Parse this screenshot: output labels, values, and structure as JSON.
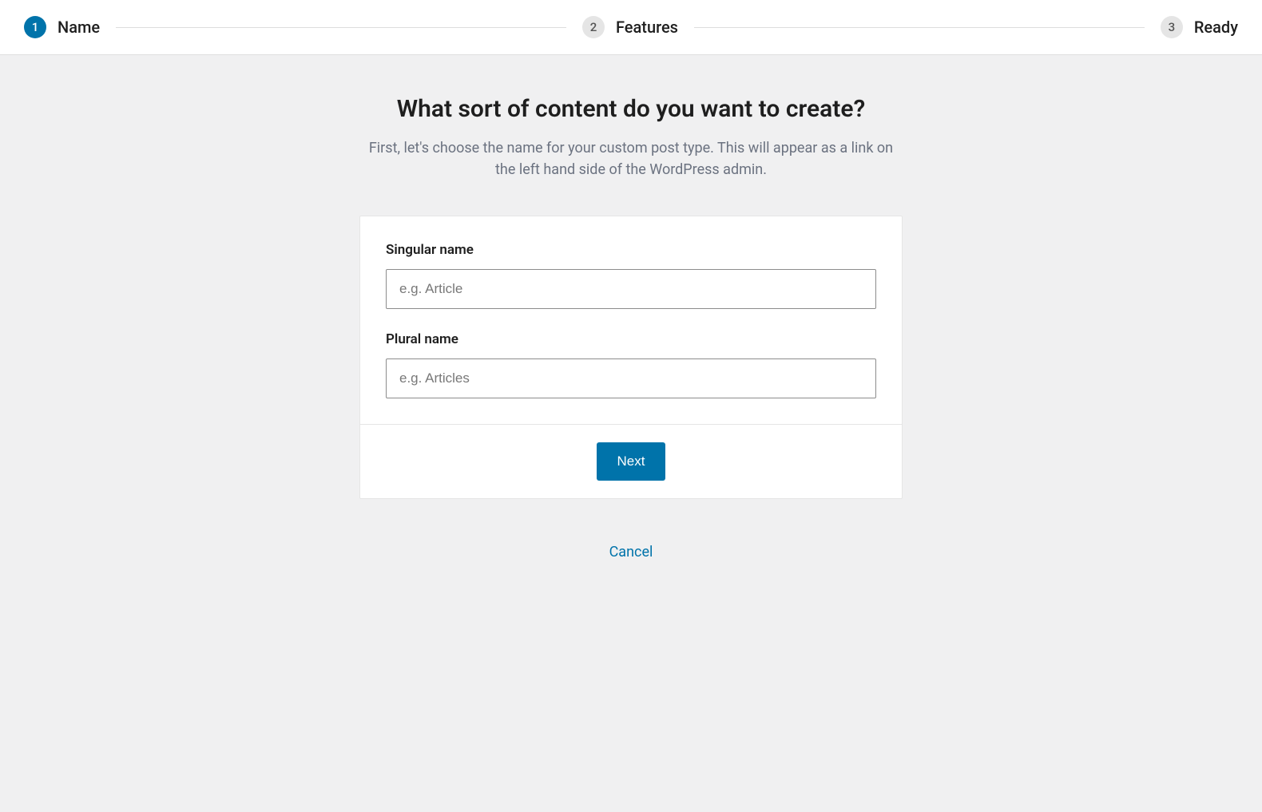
{
  "stepper": {
    "steps": [
      {
        "num": "1",
        "label": "Name",
        "active": true
      },
      {
        "num": "2",
        "label": "Features",
        "active": false
      },
      {
        "num": "3",
        "label": "Ready",
        "active": false
      }
    ]
  },
  "heading": {
    "title": "What sort of content do you want to create?",
    "subtitle": "First, let's choose the name for your custom post type. This will appear as a link on the left hand side of the WordPress admin."
  },
  "form": {
    "singular": {
      "label": "Singular name",
      "placeholder": "e.g. Article",
      "value": ""
    },
    "plural": {
      "label": "Plural name",
      "placeholder": "e.g. Articles",
      "value": ""
    },
    "next_label": "Next"
  },
  "cancel_label": "Cancel"
}
